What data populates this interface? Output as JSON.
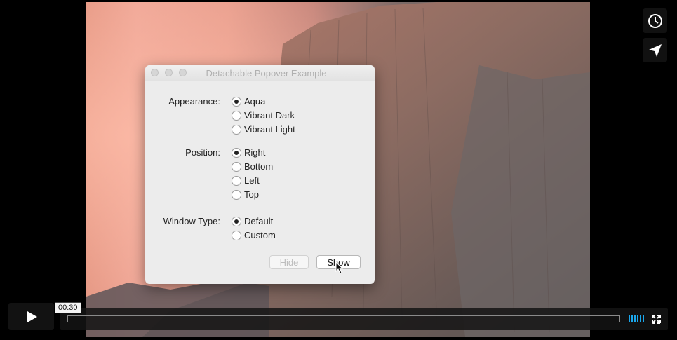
{
  "player": {
    "time": "00:30",
    "progress_fraction": 0.0,
    "icons": [
      "clock-icon",
      "paper-plane-icon",
      "play-icon",
      "volume-bars-icon",
      "fullscreen-icon"
    ],
    "accent_color": "#1aa7ec"
  },
  "window": {
    "title": "Detachable Popover Example",
    "appearance": {
      "label": "Appearance:",
      "options": [
        "Aqua",
        "Vibrant Dark",
        "Vibrant Light"
      ],
      "selected": "Aqua"
    },
    "position": {
      "label": "Position:",
      "options": [
        "Right",
        "Bottom",
        "Left",
        "Top"
      ],
      "selected": "Right"
    },
    "window_type": {
      "label": "Window Type:",
      "options": [
        "Default",
        "Custom"
      ],
      "selected": "Default"
    },
    "hide_button": "Hide",
    "show_button": "Show"
  }
}
